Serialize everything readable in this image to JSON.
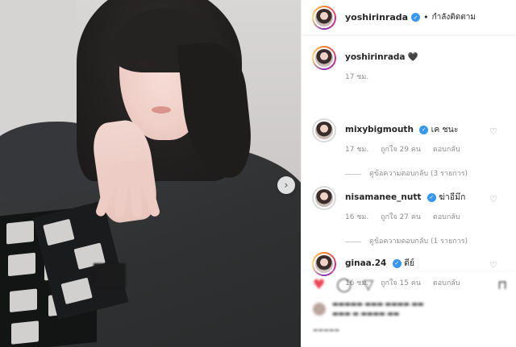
{
  "header": {
    "username": "yoshirinrada",
    "separator": "•",
    "follow_status": "กำลังติดตาม"
  },
  "caption": {
    "username": "yoshirinrada",
    "text": "🖤",
    "time": "17 ชม."
  },
  "comments": [
    {
      "username": "mixybigmouth",
      "text": "เค ชนะ",
      "time": "17 ชม.",
      "likes": "ถูกใจ 29 คน",
      "reply_label": "ตอบกลับ",
      "view_replies": "ดูข้อความตอบกลับ (3 รายการ)"
    },
    {
      "username": "nisamanee_nutt",
      "text": "ฆ่าอีมึก",
      "time": "16 ชม.",
      "likes": "ถูกใจ 27 คน",
      "reply_label": "ตอบกลับ",
      "view_replies": "ดูข้อความตอบกลับ (1 รายการ)"
    },
    {
      "username": "ginaa.24",
      "text": "ดีย์",
      "time": "16 ชม.",
      "likes": "ถูกใจ 15 คน",
      "reply_label": "ตอบกลับ"
    }
  ],
  "icons": {
    "verified": "✓",
    "heart": "♡",
    "next": "›",
    "like": "♥",
    "comment": "◯",
    "share": "▽",
    "save": "⊓"
  },
  "colors": {
    "verified_blue": "#3897f0",
    "like_red": "#ed4956",
    "muted_text": "#8e8e8e"
  }
}
